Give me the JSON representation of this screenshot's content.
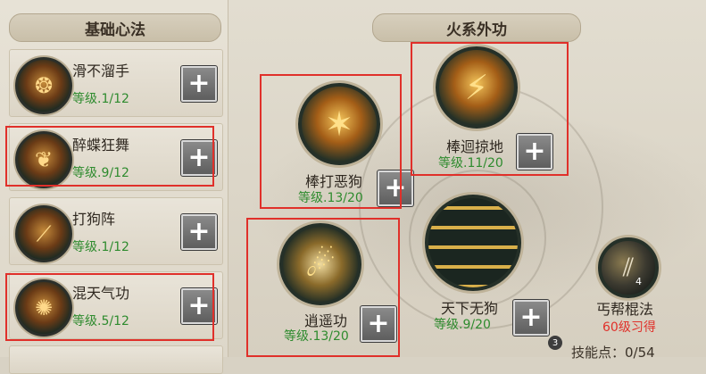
{
  "left_panel": {
    "title": "基础心法",
    "skills": [
      {
        "name": "滑不溜手",
        "level": "等级.1/12",
        "icon": "flame-icon",
        "glyph": "❂"
      },
      {
        "name": "醉蝶狂舞",
        "level": "等级.9/12",
        "icon": "butterfly-icon",
        "glyph": "❦"
      },
      {
        "name": "打狗阵",
        "level": "等级.1/12",
        "icon": "staff-array-icon",
        "glyph": "⟋"
      },
      {
        "name": "混天气功",
        "level": "等级.5/12",
        "icon": "energy-burst-icon",
        "glyph": "✺"
      }
    ]
  },
  "right_panel": {
    "title": "火系外功",
    "skills": [
      {
        "name": "棒打恶狗",
        "level": "等级.13/20",
        "icon": "staff-strike-icon",
        "glyph": "✶"
      },
      {
        "name": "棒迴掠地",
        "level": "等级.11/20",
        "icon": "staff-sweep-icon",
        "glyph": "⚡"
      },
      {
        "name": "逍遥功",
        "level": "等级.13/20",
        "icon": "wind-slash-icon",
        "glyph": "☄"
      },
      {
        "name": "天下无狗",
        "level": "等级.9/20",
        "icon": "staff-rain-icon",
        "glyph": ""
      }
    ],
    "locked_skill": {
      "name": "丐帮棍法",
      "requirement": "60级习得",
      "icon": "staff-set-icon",
      "glyph": "⫽",
      "count": "4"
    },
    "tier_badge": "3",
    "skill_points": "技能点：0/54"
  },
  "plus_label": "+"
}
